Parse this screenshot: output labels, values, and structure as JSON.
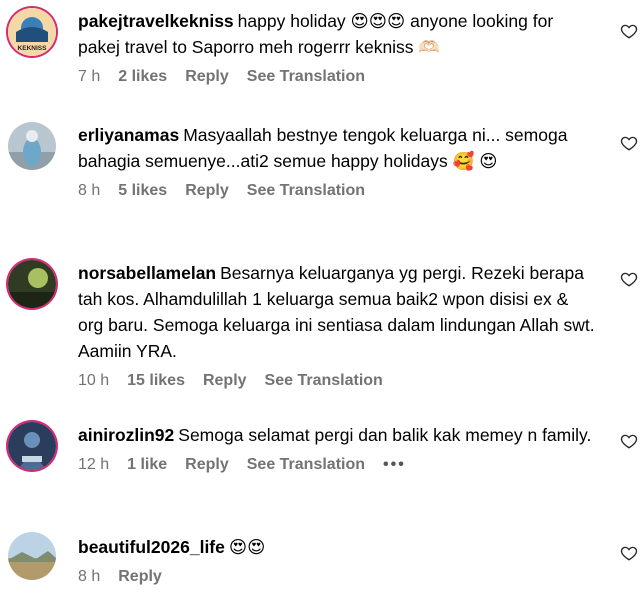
{
  "comments": [
    {
      "username": "pakejtravelkekniss",
      "text": "happy holiday 😍😍😍 anyone looking for pakej travel to Saporro meh rogerrr kekniss 🫶🏻",
      "time": "7 h",
      "likes": "2 likes",
      "reply": "Reply",
      "translate": "See Translation",
      "avatar_logo_text": "KEKNISS"
    },
    {
      "username": "erliyanamas",
      "text": "Masyaallah bestnye tengok keluarga ni... semoga bahagia semuenye...ati2 semue happy holidays 🥰 😍",
      "time": "8 h",
      "likes": "5 likes",
      "reply": "Reply",
      "translate": "See Translation"
    },
    {
      "username": "norsabellamelan",
      "text": "Besarnya keluarganya yg pergi. Rezeki berapa tah kos. Alhamdulillah 1 keluarga semua baik2 wpon disisi ex & org baru. Semoga keluarga ini sentiasa dalam lindungan Allah swt. Aamiin YRA.",
      "time": "10 h",
      "likes": "15 likes",
      "reply": "Reply",
      "translate": "See Translation"
    },
    {
      "username": "ainirozlin92",
      "text": "Semoga selamat pergi dan balik kak memey n family.",
      "time": "12 h",
      "likes": "1 like",
      "reply": "Reply",
      "translate": "See Translation",
      "more": "•••"
    },
    {
      "username": "beautiful2026_life",
      "text": "😍😍",
      "time": "8 h",
      "reply": "Reply"
    }
  ],
  "colors": {
    "story_ring": "#d62976",
    "meta_text": "#737373"
  },
  "icons": {
    "like": "heart-outline-icon"
  }
}
